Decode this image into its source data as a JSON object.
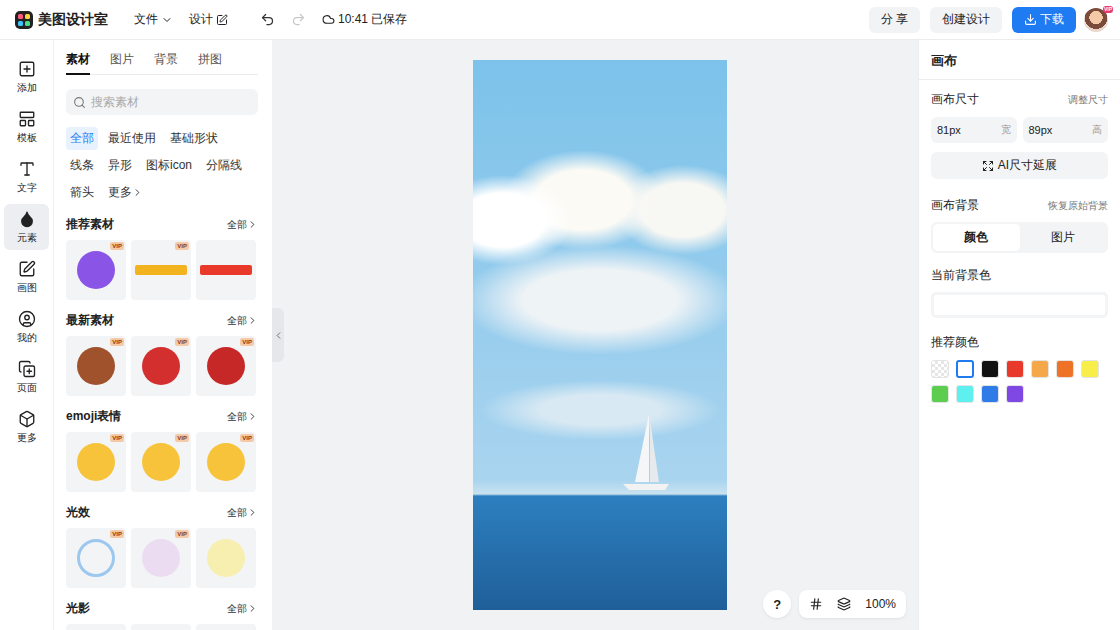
{
  "app": {
    "name": "美图设计室"
  },
  "menu": [
    {
      "label": "文件",
      "kind": "dropdown"
    },
    {
      "label": "设计",
      "kind": "edit"
    }
  ],
  "history": [
    {
      "kind": "undo",
      "disabled": false
    },
    {
      "kind": "redo",
      "disabled": true
    }
  ],
  "save_status": "10:41 已保存",
  "actions": [
    {
      "label": "分 享",
      "kind": "plain"
    },
    {
      "label": "创建设计",
      "kind": "plain"
    },
    {
      "label": "下载",
      "kind": "primary"
    }
  ],
  "badge_text": "VIP",
  "rail": [
    {
      "label": "添加",
      "kind": "add",
      "selected": false
    },
    {
      "label": "模板",
      "kind": "template",
      "selected": false
    },
    {
      "label": "文字",
      "kind": "text",
      "selected": false
    },
    {
      "label": "元素",
      "kind": "element",
      "selected": true
    },
    {
      "label": "画图",
      "kind": "draw",
      "selected": false
    },
    {
      "label": "我的",
      "kind": "mine",
      "selected": false
    },
    {
      "label": "页面",
      "kind": "page",
      "selected": false
    },
    {
      "label": "更多",
      "kind": "more",
      "selected": false
    }
  ],
  "panel": {
    "tabs": [
      {
        "label": "素材",
        "selected": true
      },
      {
        "label": "图片",
        "selected": false
      },
      {
        "label": "背景",
        "selected": false
      },
      {
        "label": "拼图",
        "selected": false
      }
    ],
    "search": {
      "placeholder": "搜索素材"
    },
    "chips": [
      {
        "label": "全部",
        "selected": true,
        "kind": "plain"
      },
      {
        "label": "最近使用",
        "selected": false,
        "kind": "plain"
      },
      {
        "label": "基础形状",
        "selected": false,
        "kind": "plain"
      },
      {
        "label": "线条",
        "selected": false,
        "kind": "plain"
      },
      {
        "label": "异形",
        "selected": false,
        "kind": "plain"
      },
      {
        "label": "图标icon",
        "selected": false,
        "kind": "plain"
      },
      {
        "label": "分隔线",
        "selected": false,
        "kind": "plain"
      },
      {
        "label": "箭头",
        "selected": false,
        "kind": "plain"
      },
      {
        "label": "更多",
        "selected": false,
        "kind": "more"
      }
    ],
    "sections": [
      {
        "title": "推荐素材",
        "more": "全部",
        "items": [
          {
            "vip": true,
            "kind": "blob",
            "color": "#8a55e6"
          },
          {
            "vip": true,
            "kind": "bar",
            "color": "#f3b31e"
          },
          {
            "vip": false,
            "kind": "bar",
            "color": "#e8392b"
          }
        ]
      },
      {
        "title": "最新素材",
        "more": "全部",
        "items": [
          {
            "vip": true,
            "kind": "blob",
            "color": "#a0522d"
          },
          {
            "vip": true,
            "kind": "blob",
            "color": "#d32f2f"
          },
          {
            "vip": true,
            "kind": "blob",
            "color": "#c62828"
          }
        ]
      },
      {
        "title": "emoji表情",
        "more": "全部",
        "items": [
          {
            "vip": true,
            "kind": "blob",
            "color": "#f6c33b"
          },
          {
            "vip": true,
            "kind": "blob",
            "color": "#f6c33b"
          },
          {
            "vip": true,
            "kind": "blob",
            "color": "#f6c33b"
          }
        ]
      },
      {
        "title": "光效",
        "more": "全部",
        "items": [
          {
            "vip": true,
            "kind": "ring",
            "color": "#9cc8f0"
          },
          {
            "vip": true,
            "kind": "blob",
            "color": "#ecdcf2"
          },
          {
            "vip": false,
            "kind": "blob",
            "color": "#f7efb0"
          }
        ]
      },
      {
        "title": "光影",
        "more": "全部",
        "items": [
          {
            "vip": false,
            "kind": "blob",
            "color": "#d6d6d6"
          },
          {
            "vip": false,
            "kind": "blob",
            "color": "#e4e4e4"
          },
          {
            "vip": false,
            "kind": "blob",
            "color": "#e0d6c8"
          }
        ]
      }
    ]
  },
  "zoom": "100%",
  "help": "?",
  "inspector": {
    "title": "画布",
    "size": {
      "label": "画布尺寸",
      "action": "调整尺寸",
      "fields": [
        {
          "value": "81px",
          "unit": "宽"
        },
        {
          "value": "89px",
          "unit": "高"
        }
      ]
    },
    "ai_button": "AI尺寸延展",
    "background": {
      "label": "画布背景",
      "action": "恢复原始背景",
      "modes": [
        {
          "label": "颜色",
          "selected": true
        },
        {
          "label": "图片",
          "selected": false
        }
      ],
      "current_label": "当前背景色",
      "current_color": "#ffffff",
      "recommended_label": "推荐颜色",
      "swatches": [
        {
          "kind": "transparent",
          "color": "#ffffff",
          "selected": false
        },
        {
          "kind": "solid",
          "color": "#ffffff",
          "selected": true
        },
        {
          "kind": "solid",
          "color": "#111111",
          "selected": false
        },
        {
          "kind": "solid",
          "color": "#e8392b",
          "selected": false
        },
        {
          "kind": "solid",
          "color": "#f4a84a",
          "selected": false
        },
        {
          "kind": "solid",
          "color": "#ee7326",
          "selected": false
        },
        {
          "kind": "solid",
          "color": "#f7ee4a",
          "selected": false
        },
        {
          "kind": "solid",
          "color": "#5ccd4e",
          "selected": false
        },
        {
          "kind": "solid",
          "color": "#5ef0ee",
          "selected": false
        },
        {
          "kind": "solid",
          "color": "#2f7be8",
          "selected": false
        },
        {
          "kind": "solid",
          "color": "#7f47e3",
          "selected": false
        }
      ]
    }
  }
}
